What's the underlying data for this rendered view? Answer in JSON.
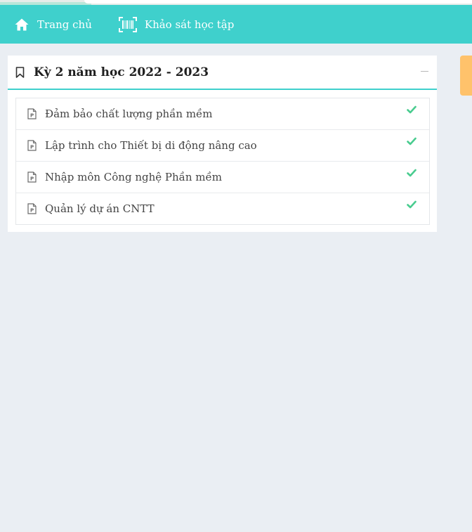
{
  "nav": {
    "items": [
      {
        "label": "Trang chủ",
        "icon": "home-icon"
      },
      {
        "label": "Khảo sát học tập",
        "icon": "barcode-scan-icon"
      }
    ]
  },
  "colors": {
    "navbar_bg": "#3fd0cc",
    "page_bg": "#eaeef3",
    "check_green": "#49cc8f",
    "side_tab": "#ffc26b"
  },
  "panel": {
    "title": "Kỳ 2 năm học 2022 - 2023",
    "icon": "bookmark-icon",
    "courses": [
      {
        "label": "Đảm bảo chất lượng phần mềm",
        "completed": true
      },
      {
        "label": "Lập trình cho Thiết bị di động nâng cao",
        "completed": true
      },
      {
        "label": "Nhập môn Công nghệ Phần mềm",
        "completed": true
      },
      {
        "label": "Quản lý dự án CNTT",
        "completed": true
      }
    ]
  }
}
